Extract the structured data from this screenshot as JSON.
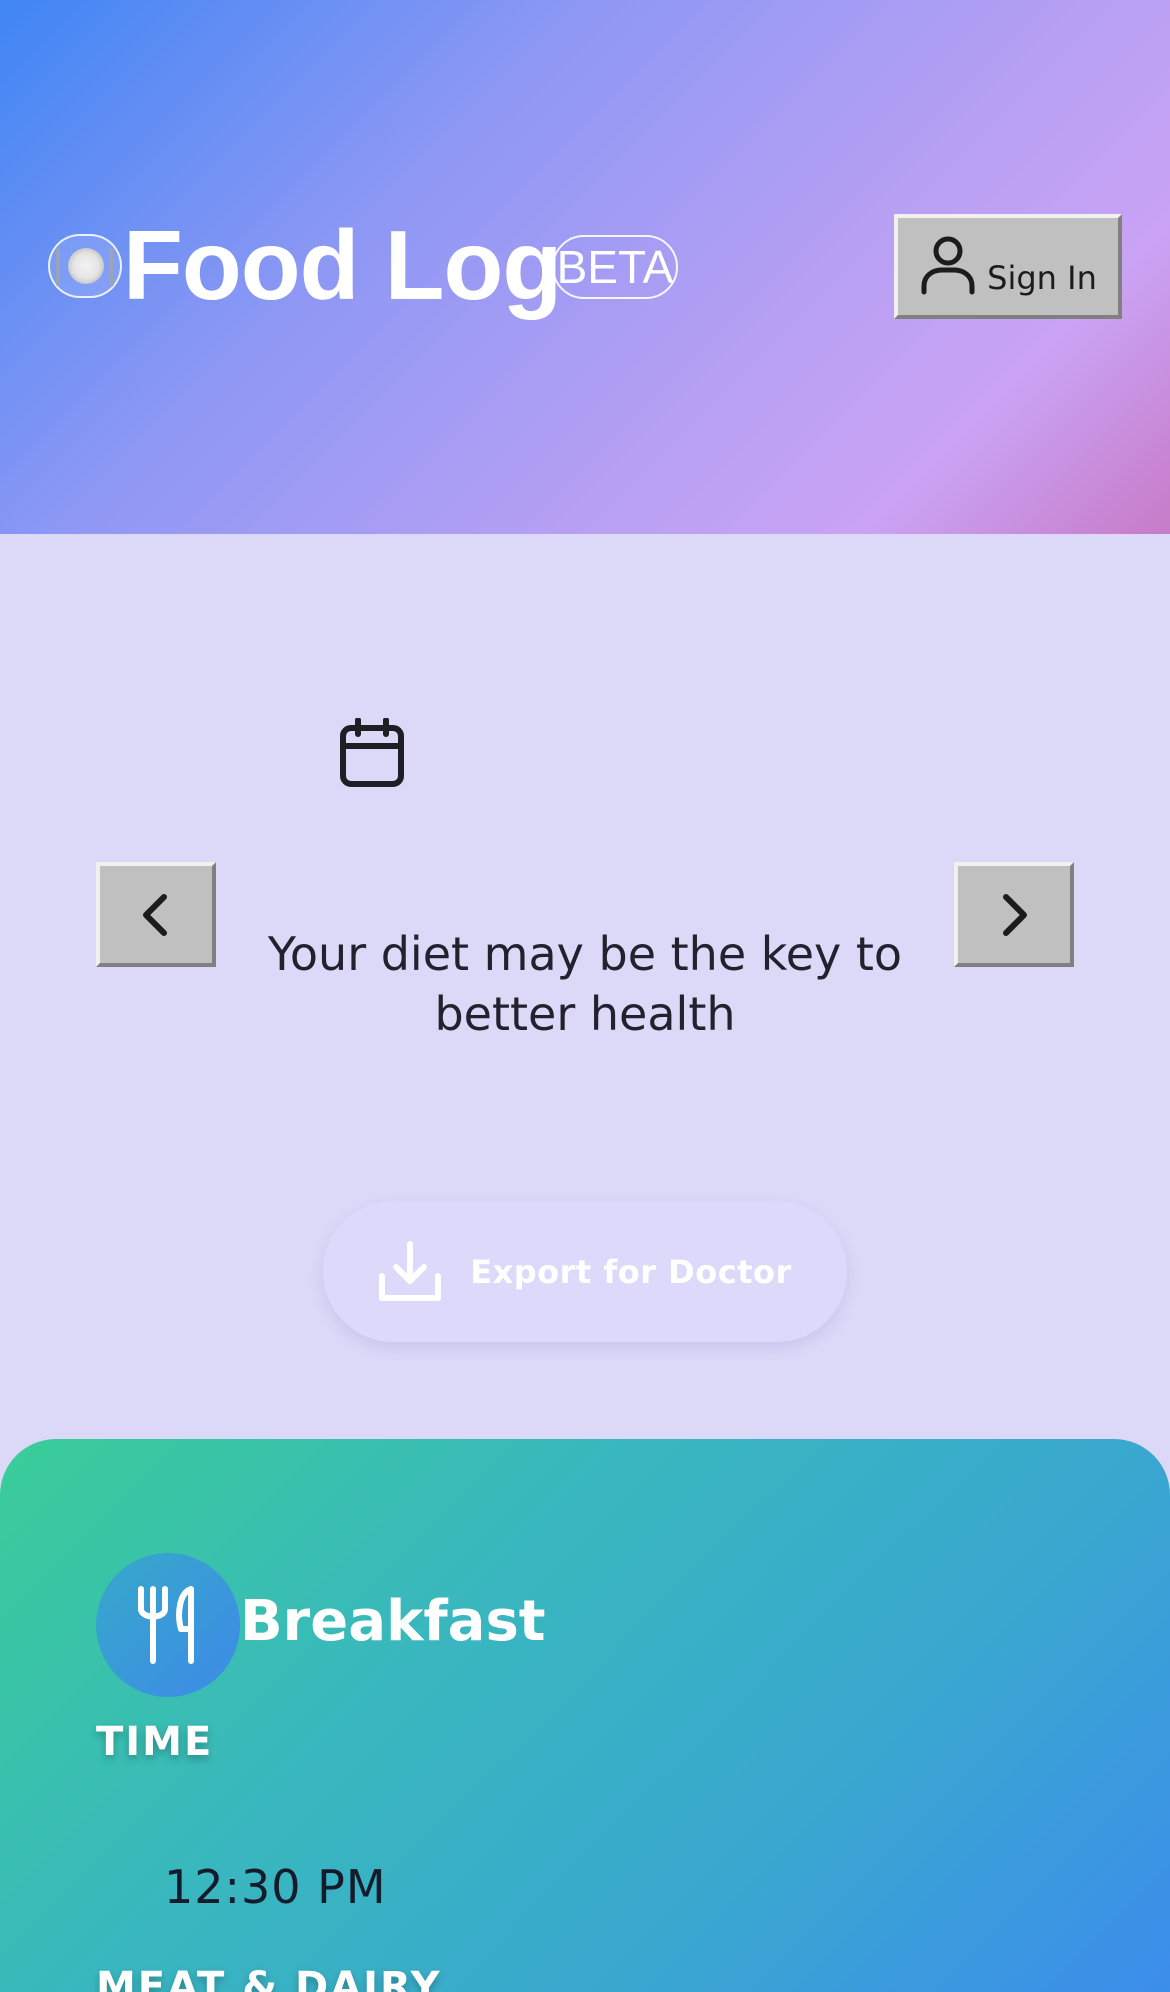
{
  "header": {
    "app_title": "Food Log",
    "badge": "BETA",
    "sign_in_label": "Sign In",
    "logo_icon": "plate-with-cutlery-icon",
    "user_icon": "user-icon"
  },
  "date_nav": {
    "calendar_icon": "calendar-icon",
    "prev_icon": "chevron-left-icon",
    "next_icon": "chevron-right-icon",
    "tagline": "Your diet may be the key to better health"
  },
  "export": {
    "label": "Export for Doctor",
    "icon": "download-icon"
  },
  "meal": {
    "title": "Breakfast",
    "icon": "fork-knife-icon",
    "time_label": "TIME",
    "time_value": "12:30 PM",
    "category_label": "MEAT & DAIRY"
  },
  "colors": {
    "header_gradient_start": "#3f86f4",
    "header_gradient_end": "#c77bc8",
    "page_background": "#dcd9f8",
    "card_gradient_start": "#3acd98",
    "card_gradient_end": "#3d8aef"
  }
}
